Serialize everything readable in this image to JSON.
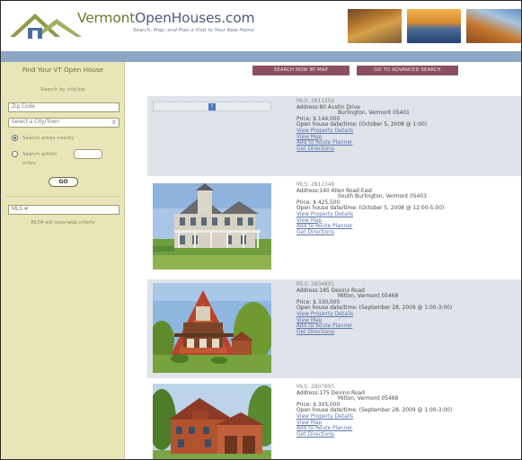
{
  "header": {
    "site_name_part1": "Vermont",
    "site_name_part2": "OpenHouses",
    "site_name_part3": ".com",
    "tagline": "Search, Map, and Plan a Visit to Your New Home"
  },
  "sidebar": {
    "title": "Find Your VT Open House",
    "subtitle": "Search by city/zip",
    "zip_placeholder": "Zip Code",
    "city_select": "Select a City/Town",
    "radio_nearby": "Search areas nearby",
    "radio_within": "Search within",
    "miles_label": "miles",
    "go_label": "GO",
    "mls_placeholder": "MLS #",
    "mls_note": "MLS# will supersede criteria"
  },
  "main": {
    "search_map_button": "SEARCH NOW BY MAP",
    "advanced_button": "GO TO ADVANCED SEARCH"
  },
  "listings": [
    {
      "mls": "MLS: 2811256",
      "address_line1": "Address:80 Austin Drive",
      "address_line2": "Burlington, Vermont 05401",
      "price": "Price: $ 144,000",
      "open_house": "Open house date/time: (October 5, 2008 @ 1:00)",
      "link_details": "View Property Details",
      "link_map": "View Map",
      "link_route": "Add to Route Planner",
      "link_directions": "Get Directions"
    },
    {
      "mls": "MLS: 2811346",
      "address_line1": "Address:140 Allen Road East",
      "address_line2": "South Burlington, Vermont 05403",
      "price": "Price: $ 425,500",
      "open_house": "Open house date/time: (October 5, 2008 @ 12:00-5:00)",
      "link_details": "View Property Details",
      "link_map": "View Map",
      "link_route": "Add to Route Planner",
      "link_directions": "Get Directions"
    },
    {
      "mls": "MLS: 2804891",
      "address_line1": "Address:185 Devino Road",
      "address_line2": "Milton, Vermont 05468",
      "price": "Price: $ 330,000",
      "open_house": "Open house date/time: (September 28, 2009 @ 1:00-3:00)",
      "link_details": "View Property Details",
      "link_map": "View Map",
      "link_route": "Add to Route Planner",
      "link_directions": "Get Directions"
    },
    {
      "mls": "MLS: 2807895",
      "address_line1": "Address:175 Devino Road",
      "address_line2": "Milton, Vermont 05468",
      "price": "Price: $ 305,000",
      "open_house": "Open house date/time: (September 28, 2009 @ 1:00-3:00)",
      "link_details": "View Property Details",
      "link_map": "View Map",
      "link_route": "Add to Route Planner",
      "link_directions": "Get Directions"
    }
  ],
  "colors": {
    "sidebar_bg": "#e8e6b8",
    "band_blue": "#8da6c6",
    "button_maroon": "#8a5060",
    "link_blue": "#5b78a8",
    "listing_shade": "#dfe3ea"
  }
}
